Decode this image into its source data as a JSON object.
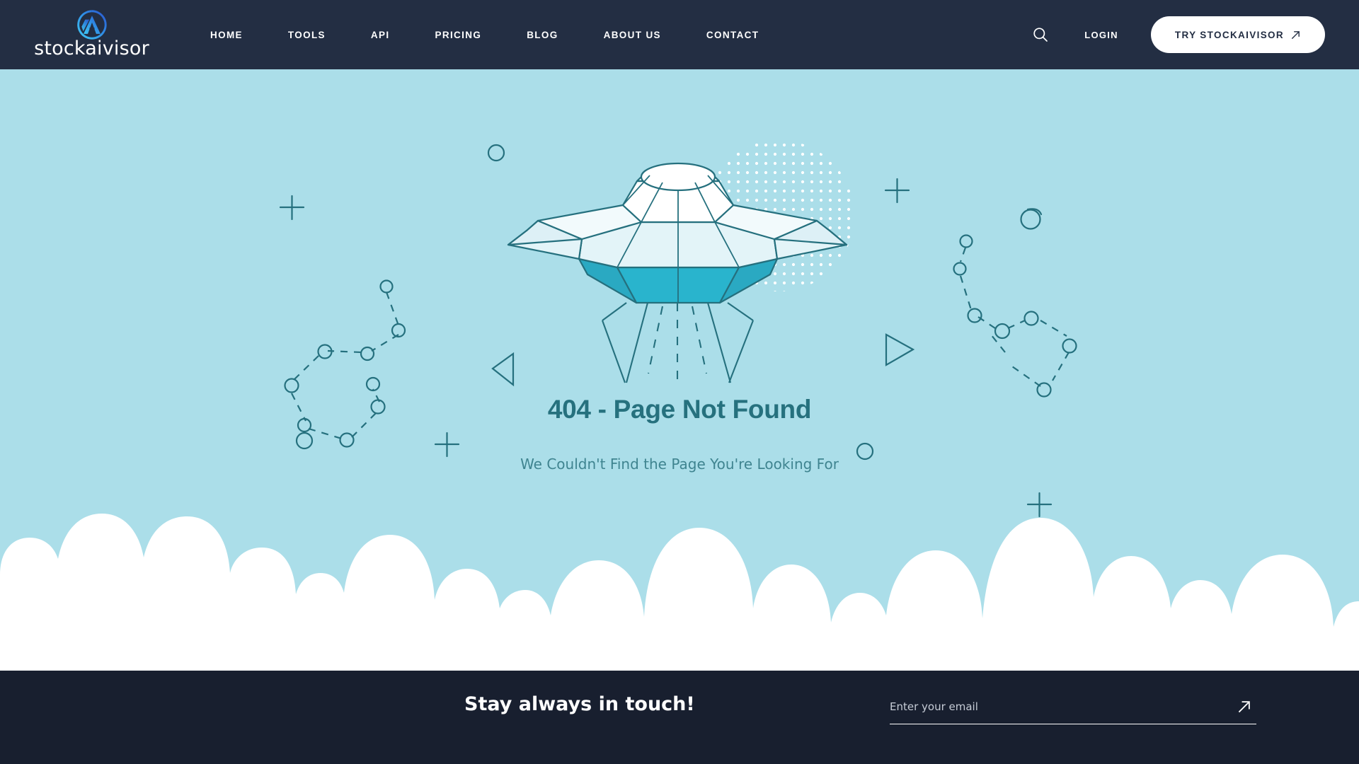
{
  "brand": {
    "name": "stockaivisor",
    "logo_icon": "stockaivisor-monogram-icon",
    "logo_color_start": "#3fc0f0",
    "logo_color_end": "#2a5fd6"
  },
  "header": {
    "background": "#232e43",
    "nav": [
      {
        "label": "HOME",
        "name": "nav-home"
      },
      {
        "label": "TOOLS",
        "name": "nav-tools"
      },
      {
        "label": "API",
        "name": "nav-api"
      },
      {
        "label": "PRICING",
        "name": "nav-pricing"
      },
      {
        "label": "BLOG",
        "name": "nav-blog"
      },
      {
        "label": "ABOUT US",
        "name": "nav-about-us"
      },
      {
        "label": "CONTACT",
        "name": "nav-contact"
      }
    ],
    "search_icon": "search-icon",
    "login_label": "LOGIN",
    "cta_label": "TRY STOCKAIVISOR",
    "cta_icon": "arrow-up-right-icon"
  },
  "hero": {
    "background": "#abdee9",
    "illustration": "ufo-flying-saucer-illustration",
    "title": "404 - Page Not Found",
    "subtitle": "We Couldn't Find the Page You're Looking For",
    "title_color": "#26717e",
    "subtitle_color": "#3f8490",
    "line_color": "#25707e",
    "ufo_body_color": "#29b4cd",
    "ufo_dome_color": "#ffffff",
    "ufo_mid_color": "#e3f4f8",
    "decorations": [
      {
        "name": "plus-decoration",
        "shape": "plus"
      },
      {
        "name": "circle-decoration",
        "shape": "circle"
      },
      {
        "name": "triangle-left-decoration",
        "shape": "triangle-left"
      },
      {
        "name": "triangle-right-decoration",
        "shape": "triangle-right"
      },
      {
        "name": "constellation-left-decoration",
        "shape": "constellation"
      },
      {
        "name": "constellation-right-decoration",
        "shape": "constellation"
      },
      {
        "name": "dot-grid-decoration",
        "shape": "dot-grid"
      }
    ]
  },
  "clouds": {
    "color": "#ffffff"
  },
  "footer": {
    "background": "#181f2f",
    "title": "Stay always in touch!",
    "email_placeholder": "Enter your email",
    "email_value": "",
    "submit_icon": "arrow-up-right-icon"
  }
}
